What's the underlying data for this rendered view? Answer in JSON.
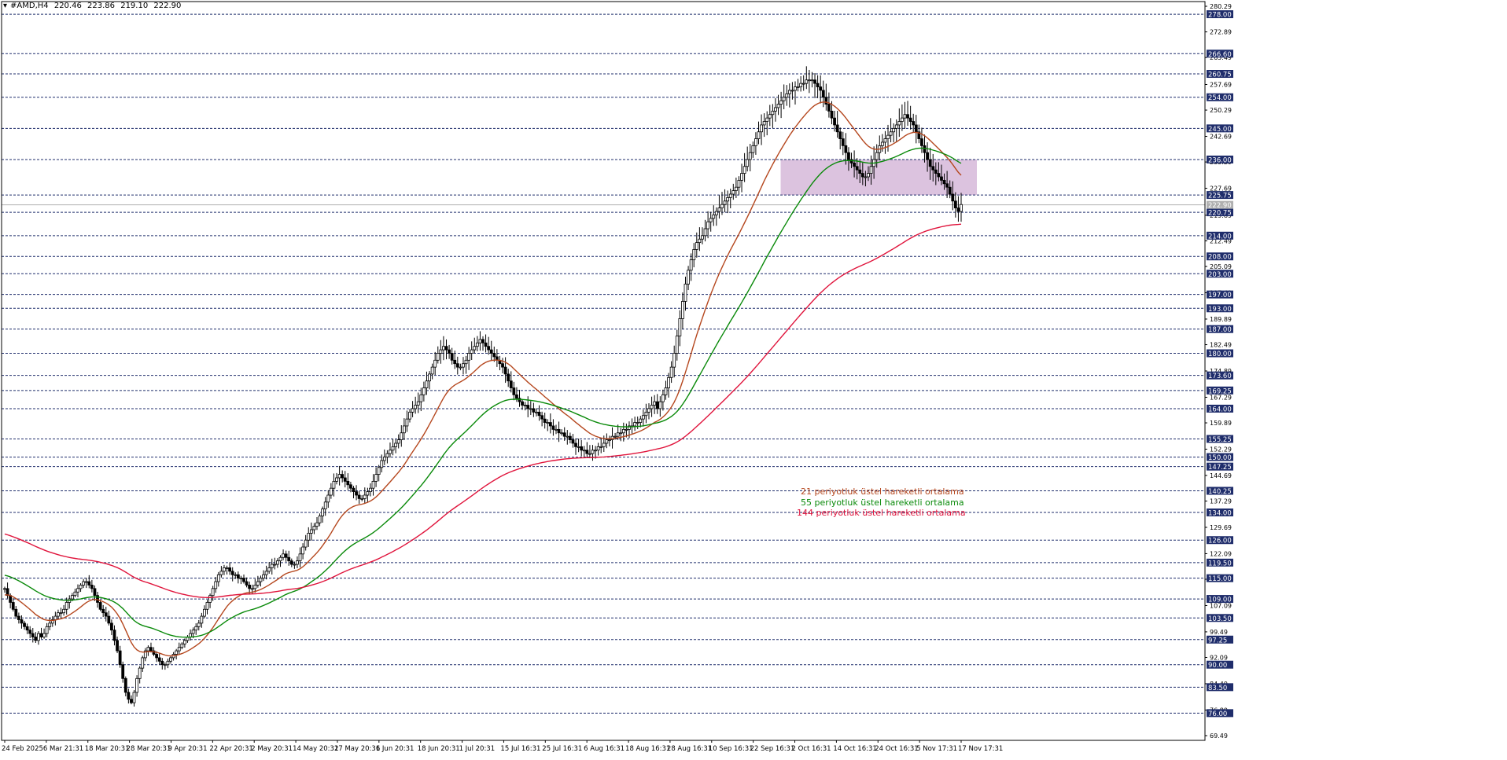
{
  "header": {
    "symbol": "#AMD,H4",
    "open": "220.46",
    "high": "223.86",
    "low": "219.10",
    "close": "222.90"
  },
  "colors": {
    "background": "#ffffff",
    "candle": "#000000",
    "grid": "#1f2d6b",
    "label_bg": "#1f2d6b",
    "label_text": "#ffffff",
    "ema21": "#b5471e",
    "ema55": "#0a8a0a",
    "ema144": "#e0143c",
    "zone_fill": "#d6b8d9"
  },
  "legend": {
    "ema21": "21 periyotluk üstel hareketli ortalama",
    "ema55": "55 periyotluk üstel hareketli ortalama",
    "ema144": "144 periyotluk üstel hareketli ortalama"
  },
  "chart_data": {
    "type": "candlestick",
    "ylim": [
      69.49,
      280.29
    ],
    "current_price": 222.9,
    "price_ticks": [
      "280.29",
      "272.89",
      "265.49",
      "257.69",
      "250.29",
      "242.69",
      "235.29",
      "227.69",
      "219.89",
      "212.49",
      "205.09",
      "197.49",
      "189.89",
      "182.49",
      "174.89",
      "167.29",
      "159.89",
      "152.29",
      "144.69",
      "137.29",
      "129.69",
      "122.09",
      "114.69",
      "107.09",
      "99.49",
      "92.09",
      "84.49",
      "76.89",
      "69.49"
    ],
    "levels": [
      278.0,
      266.6,
      260.75,
      254.0,
      245.0,
      236.0,
      225.75,
      220.75,
      214.0,
      208.0,
      203.0,
      197.0,
      193.0,
      187.0,
      180.0,
      173.6,
      169.25,
      164.0,
      155.25,
      150.0,
      147.25,
      140.25,
      134.0,
      126.0,
      119.5,
      115.0,
      109.0,
      103.5,
      97.25,
      90.0,
      83.5,
      76.0
    ],
    "level_labels": [
      "278.00",
      "266.60",
      "260.75",
      "254.00",
      "245.00",
      "236.00",
      "225.75",
      "220.75",
      "214.00",
      "208.00",
      "203.00",
      "197.00",
      "193.00",
      "187.00",
      "180.00",
      "173.60",
      "169.25",
      "164.00",
      "155.25",
      "150.00",
      "147.25",
      "140.25",
      "134.00",
      "126.00",
      "119.50",
      "115.00",
      "109.00",
      "103.50",
      "97.25",
      "90.00",
      "83.50",
      "76.00"
    ],
    "current_label": "222.90",
    "zone": {
      "from_date": "2 Oct 16:31",
      "to_date": "17 Nov 17:31",
      "low": 225.75,
      "high": 236.0
    },
    "time_labels": [
      "24 Feb 2025",
      "6 Mar 21:31",
      "18 Mar 20:31",
      "28 Mar 20:31",
      "9 Apr 20:31",
      "22 Apr 20:31",
      "2 May 20:31",
      "14 May 20:31",
      "27 May 20:31",
      "6 Jun 20:31",
      "18 Jun 20:31",
      "1 Jul 20:31",
      "15 Jul 16:31",
      "25 Jul 16:31",
      "6 Aug 16:31",
      "18 Aug 16:31",
      "28 Aug 16:31",
      "10 Sep 16:31",
      "22 Sep 16:31",
      "2 Oct 16:31",
      "14 Oct 16:31",
      "24 Oct 16:31",
      "5 Nov 17:31",
      "17 Nov 17:31"
    ],
    "closes": [
      112,
      110,
      108,
      106,
      104,
      103,
      102,
      101,
      100,
      99,
      98,
      97,
      99,
      98,
      99,
      101,
      102,
      103,
      104,
      105,
      105,
      106,
      108,
      109,
      110,
      111,
      112,
      113,
      114,
      114,
      113,
      112,
      110,
      108,
      106,
      105,
      104,
      102,
      100,
      97,
      94,
      90,
      86,
      82,
      80,
      79,
      82,
      86,
      89,
      92,
      94,
      95,
      94,
      93,
      92,
      91,
      90,
      90,
      91,
      92,
      93,
      94,
      95,
      96,
      97,
      98,
      99,
      100,
      101,
      102,
      104,
      106,
      108,
      110,
      112,
      114,
      116,
      117,
      118,
      118,
      117,
      116,
      116,
      115,
      115,
      114,
      113,
      112,
      112,
      113,
      114,
      115,
      116,
      117,
      118,
      119,
      119,
      120,
      121,
      122,
      121,
      120,
      119,
      119,
      120,
      122,
      124,
      126,
      128,
      129,
      130,
      131,
      133,
      135,
      137,
      139,
      141,
      143,
      144,
      145,
      144,
      143,
      142,
      141,
      140,
      139,
      138,
      138,
      139,
      140,
      141,
      143,
      145,
      147,
      149,
      150,
      151,
      152,
      153,
      154,
      155,
      157,
      159,
      161,
      163,
      164,
      165,
      166,
      168,
      170,
      172,
      174,
      176,
      178,
      180,
      181,
      182,
      181,
      180,
      178,
      177,
      176,
      176,
      177,
      178,
      180,
      181,
      182,
      183,
      184,
      183,
      182,
      181,
      180,
      179,
      178,
      177,
      176,
      174,
      172,
      170,
      168,
      167,
      166,
      165,
      165,
      164,
      164,
      163,
      163,
      162,
      161,
      160,
      160,
      159,
      158,
      158,
      157,
      157,
      156,
      156,
      155,
      154,
      153,
      153,
      152,
      152,
      151,
      151,
      152,
      152,
      153,
      153,
      154,
      155,
      155,
      156,
      156,
      157,
      157,
      158,
      158,
      159,
      159,
      160,
      160,
      161,
      162,
      163,
      164,
      165,
      166,
      164,
      166,
      168,
      170,
      173,
      176,
      180,
      185,
      190,
      195,
      200,
      204,
      207,
      210,
      212,
      213,
      214,
      216,
      218,
      219,
      220,
      221,
      222,
      223,
      224,
      225,
      226,
      227,
      228,
      230,
      232,
      234,
      236,
      238,
      240,
      242,
      244,
      246,
      247,
      248,
      249,
      250,
      251,
      252,
      253,
      254,
      255,
      256,
      256,
      257,
      257,
      258,
      258,
      259,
      259,
      259,
      258,
      257,
      256,
      254,
      252,
      250,
      248,
      246,
      244,
      242,
      240,
      238,
      236,
      235,
      234,
      233,
      232,
      231,
      231,
      232,
      234,
      236,
      238,
      240,
      241,
      242,
      243,
      244,
      245,
      246,
      247,
      248,
      249,
      248,
      247,
      246,
      244,
      242,
      240,
      238,
      236,
      234,
      233,
      232,
      231,
      230,
      229,
      228,
      226,
      224,
      222,
      221,
      223
    ],
    "series": [
      {
        "name": "21 periyotluk üstel hareketli ortalama",
        "period": 21
      },
      {
        "name": "55 periyotluk üstel hareketli ortalama",
        "period": 55
      },
      {
        "name": "144 periyotluk üstel hareketli ortalama",
        "period": 144
      }
    ]
  }
}
